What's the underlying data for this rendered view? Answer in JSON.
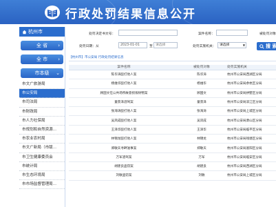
{
  "header": {
    "title": "行政处罚结果信息公开"
  },
  "sidebar": {
    "city": "杭州市",
    "level_buttons": [
      "全 省",
      "全 市",
      "市本级"
    ],
    "items": [
      "市文广旅游局",
      "市公安局",
      "市司法局",
      "市财政局",
      "市人力社保局",
      "市规划和自然资源...",
      "市农业农村局",
      "市文广新局（市版...",
      "市卫生健康委员会",
      "市统计局",
      "市生态环境局",
      "市市场监督管理局..."
    ],
    "active_index": 1
  },
  "search": {
    "decision_no_label": "处罚决定书文号：",
    "case_name_label": "案件名称：",
    "party_label": "被处罚对象",
    "date_label": "处罚日期：从",
    "date_from": "2023-01-01",
    "to_label": "至",
    "date_to_placeholder": "请选择",
    "org_label": "处罚实施机关：",
    "org_value": "请选择",
    "button": "搜 索"
  },
  "breadcrumb": "【杭州市】市公安局 行政处罚结果信息",
  "table": {
    "headers": [
      "案件名称",
      "被处罚对象",
      "处罚实施机关"
    ],
    "rows": [
      [
        "陈华涛殴打他人案",
        "陈华涛",
        "杭州市公安局西湖区分局"
      ],
      [
        "杨维华殴打他人案",
        "杨维华",
        "杭州市公安局余杭区分局"
      ],
      [
        "顾国文在公共场所故意损毁财物案",
        "顾国文",
        "杭州市公安局拱墅区分局"
      ],
      [
        "童景泽酒驾案",
        "童景泽",
        "杭州市公安局滨江区分局"
      ],
      [
        "张海涛殴打他人案",
        "张海涛",
        "杭州市公安局上城区分局"
      ],
      [
        "吴凤成殴打他人案",
        "吴凤成",
        "杭州市公安局萧山区分局"
      ],
      [
        "王泽华殴打他人案",
        "王泽华",
        "杭州市公安局临平区分局"
      ],
      [
        "林锦龙殴打他人案",
        "林锦龙",
        "杭州市公安局钱塘区分局"
      ],
      [
        "郑敏天寻衅滋事案",
        "郑敏天",
        "杭州市公安局富阳区分局"
      ],
      [
        "万军酒驾案",
        "万军",
        "杭州市公安局临安区分局"
      ],
      [
        "胡建良盗窃案",
        "胡建良",
        "杭州市公安局西湖区分局"
      ],
      [
        "刘敏盗窃案",
        "刘敏",
        "杭州市公安局上城区分局"
      ]
    ]
  },
  "colors": {
    "banner": "#2a62c2",
    "accent": "#2b6dcd"
  }
}
